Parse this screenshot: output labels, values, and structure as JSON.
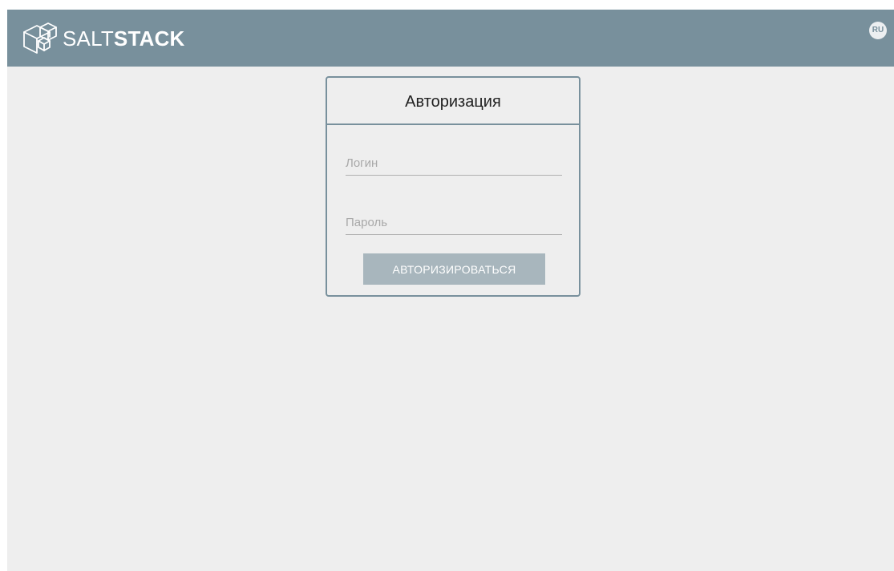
{
  "header": {
    "brand_light": "SALT",
    "brand_bold": "STACK",
    "logo_icon": "saltstack-cube-icon",
    "language": "RU"
  },
  "login": {
    "title": "Авторизация",
    "username_placeholder": "Логин",
    "username_value": "",
    "password_placeholder": "Пароль",
    "password_value": "",
    "submit_label": "АВТОРИЗИРОВАТЬСЯ"
  },
  "colors": {
    "topbar": "#78909c",
    "background": "#eeeeee",
    "button_disabled": "#a8b6bd",
    "card_border": "#78909c"
  }
}
